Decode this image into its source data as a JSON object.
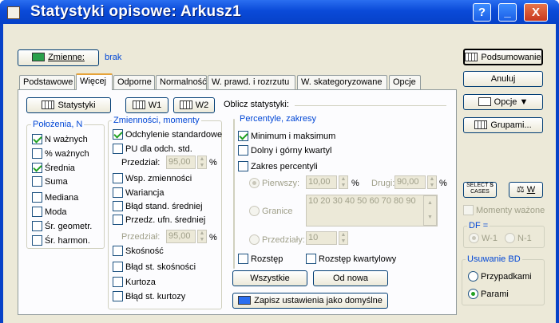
{
  "window": {
    "title": "Statystyki opisowe: Arkusz1",
    "help": "?",
    "minimize": "_",
    "close": "X"
  },
  "variables": {
    "button": "Zmienne:",
    "value": "brak"
  },
  "tabs": [
    "Podstawowe",
    "Więcej",
    "Odporne",
    "Normalność",
    "W. prawd. i rozrzutu",
    "W. skategoryzowane",
    "Opcje"
  ],
  "toolbar": {
    "stats": "Statystyki",
    "w1": "W1",
    "w2": "W2",
    "compute": "Oblicz statystyki:"
  },
  "location": {
    "title": "Położenia, N",
    "items": [
      {
        "label": "N ważnych",
        "checked": true
      },
      {
        "label": "% ważnych",
        "checked": false
      },
      {
        "label": "Średnia",
        "checked": true
      },
      {
        "label": "Suma",
        "checked": false
      },
      {
        "label": "Mediana",
        "checked": false
      },
      {
        "label": "Moda",
        "checked": false
      },
      {
        "label": "Śr. geometr.",
        "checked": false
      },
      {
        "label": "Śr. harmon.",
        "checked": false
      }
    ]
  },
  "variability": {
    "title": "Zmienności, momenty",
    "std": "Odchylenie standardowe",
    "pu": "PU dla odch. std.",
    "interval": "Przedział:",
    "interval_val": "95,00",
    "pct": "%",
    "cv": "Wsp. zmienności",
    "var": "Wariancja",
    "sem": "Błąd stand. średniej",
    "pu_mean": "Przedz. ufn. średniej",
    "interval2": "Przedział:",
    "interval2_val": "95,00",
    "skew": "Skośność",
    "skew_err": "Błąd st. skośności",
    "kurt": "Kurtoza",
    "kurt_err": "Błąd st. kurtozy"
  },
  "percentiles": {
    "title": "Percentyle, zakresy",
    "minmax": "Minimum i maksimum",
    "quartiles": "Dolny i górny kwartyl",
    "range": "Zakres percentyli",
    "first": "Pierwszy:",
    "first_val": "10,00",
    "second": "Drugi:",
    "second_val": "90,00",
    "pct": "%",
    "bounds": "Granice",
    "bounds_val": "10 20 30 40 50 60 70 80 90",
    "intervals": "Przedziały:",
    "intervals_val": "10",
    "spread": "Rozstęp",
    "iqr": "Rozstęp kwartylowy"
  },
  "buttons": {
    "all": "Wszystkie",
    "reset": "Od nowa",
    "save": "Zapisz ustawienia jako domyślne"
  },
  "right": {
    "summary": "Podsumowanie",
    "cancel": "Anuluj",
    "options": "Opcje",
    "group": "Grupami...",
    "select_line1": "SELECT",
    "select_line2": "CASES",
    "s": "S",
    "w": "W",
    "weighted": "Momenty ważone",
    "df_title": "DF =",
    "w1": "W-1",
    "n1": "N-1",
    "bd_title": "Usuwanie BD",
    "casewise": "Przypadkami",
    "pairwise": "Parami"
  }
}
